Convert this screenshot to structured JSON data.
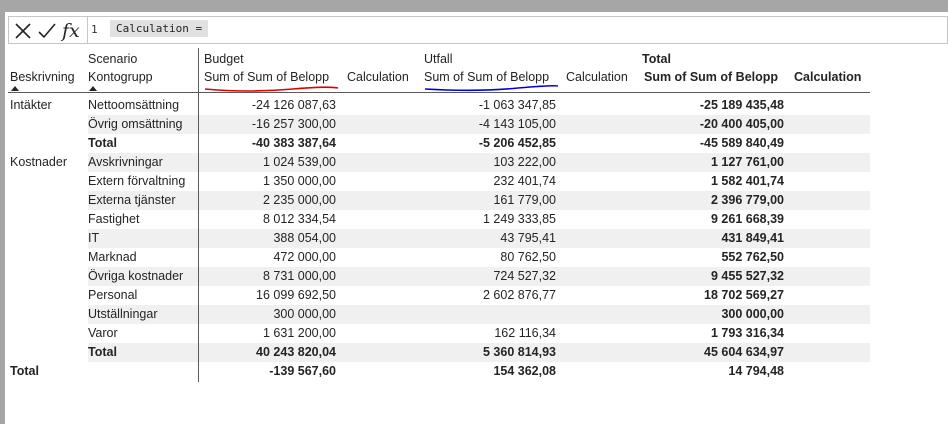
{
  "formula_bar": {
    "line_number": "1",
    "expression": "Calculation ="
  },
  "matrix": {
    "headers": {
      "scenario_label": "Scenario",
      "beskrivning_label": "Beskrivning",
      "kontogrupp_label": "Kontogrupp",
      "budget": "Budget",
      "utfall": "Utfall",
      "total": "Total",
      "measure": "Sum of Sum of Belopp",
      "calculation": "Calculation"
    },
    "rows": [
      {
        "group": "Intäkter",
        "item": "Nettoomsättning",
        "budget": "-24 126 087,63",
        "utfall": "-1 063 347,85",
        "total": "-25 189 435,48"
      },
      {
        "group": "",
        "item": "Övrig omsättning",
        "budget": "-16 257 300,00",
        "utfall": "-4 143 105,00",
        "total": "-20 400 405,00"
      },
      {
        "group": "",
        "item": "Total",
        "budget": "-40 383 387,64",
        "utfall": "-5 206 452,85",
        "total": "-45 589 840,49",
        "subtotal": true
      },
      {
        "group": "Kostnader",
        "item": "Avskrivningar",
        "budget": "1 024 539,00",
        "utfall": "103 222,00",
        "total": "1 127 761,00"
      },
      {
        "group": "",
        "item": "Extern förvaltning",
        "budget": "1 350 000,00",
        "utfall": "232 401,74",
        "total": "1 582 401,74"
      },
      {
        "group": "",
        "item": "Externa tjänster",
        "budget": "2 235 000,00",
        "utfall": "161 779,00",
        "total": "2 396 779,00"
      },
      {
        "group": "",
        "item": "Fastighet",
        "budget": "8 012 334,54",
        "utfall": "1 249 333,85",
        "total": "9 261 668,39"
      },
      {
        "group": "",
        "item": "IT",
        "budget": "388 054,00",
        "utfall": "43 795,41",
        "total": "431 849,41"
      },
      {
        "group": "",
        "item": "Marknad",
        "budget": "472 000,00",
        "utfall": "80 762,50",
        "total": "552 762,50"
      },
      {
        "group": "",
        "item": "Övriga kostnader",
        "budget": "8 731 000,00",
        "utfall": "724 527,32",
        "total": "9 455 527,32"
      },
      {
        "group": "",
        "item": "Personal",
        "budget": "16 099 692,50",
        "utfall": "2 602 876,77",
        "total": "18 702 569,27"
      },
      {
        "group": "",
        "item": "Utställningar",
        "budget": "300 000,00",
        "utfall": "",
        "total": "300 000,00"
      },
      {
        "group": "",
        "item": "Varor",
        "budget": "1 631 200,00",
        "utfall": "162 116,34",
        "total": "1 793 316,34"
      },
      {
        "group": "",
        "item": "Total",
        "budget": "40 243 820,04",
        "utfall": "5 360 814,93",
        "total": "45 604 634,97",
        "subtotal": true
      }
    ],
    "grand_total": {
      "label": "Total",
      "budget": "-139 567,60",
      "utfall": "154 362,08",
      "total": "14 794,48"
    }
  },
  "annotations": {
    "budget_underline_color": "#e00000",
    "utfall_underline_color": "#0000e0"
  },
  "icons": {
    "cancel": "close-icon",
    "commit": "check-icon",
    "function": "fx-icon",
    "sort": "sort-ascending-icon"
  }
}
